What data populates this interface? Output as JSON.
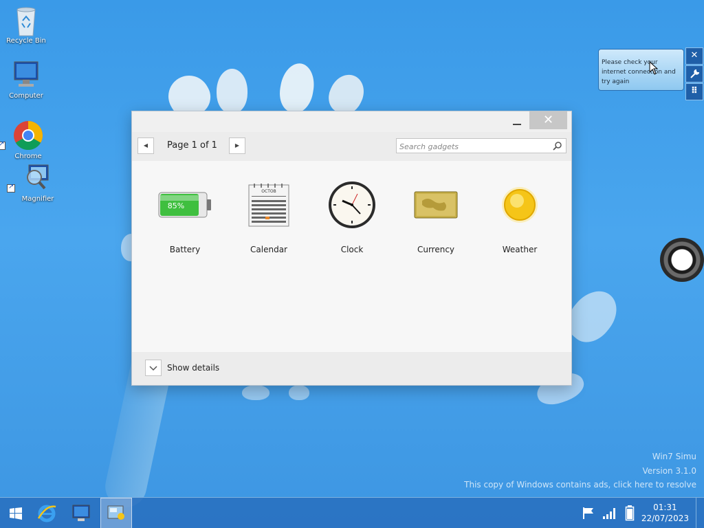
{
  "desktop": {
    "icons": [
      {
        "label": "Recycle Bin"
      },
      {
        "label": "Computer"
      },
      {
        "label": "Chrome"
      },
      {
        "label": "Magnifier"
      }
    ]
  },
  "gadget_window": {
    "page_label": "Page 1 of 1",
    "search_placeholder": "Search gadgets",
    "gadgets": [
      {
        "label": "Battery",
        "battery_text": "85%",
        "battery_level": 0.85
      },
      {
        "label": "Calendar",
        "month_text": "OCTOB"
      },
      {
        "label": "Clock"
      },
      {
        "label": "Currency"
      },
      {
        "label": "Weather"
      }
    ],
    "details_label": "Show details"
  },
  "notification": {
    "text": "Please check your internet connection and try again"
  },
  "watermark": {
    "line1": "Win7 Simu",
    "line2": "Version 3.1.0",
    "line3": "This copy of Windows contains ads, click here to resolve"
  },
  "taskbar": {
    "time": "01:31",
    "date": "22/07/2023"
  },
  "colors": {
    "desktop_blue": "#3a9ae8",
    "taskbar": "#286ebe",
    "battery_green": "#3fbf3f"
  }
}
